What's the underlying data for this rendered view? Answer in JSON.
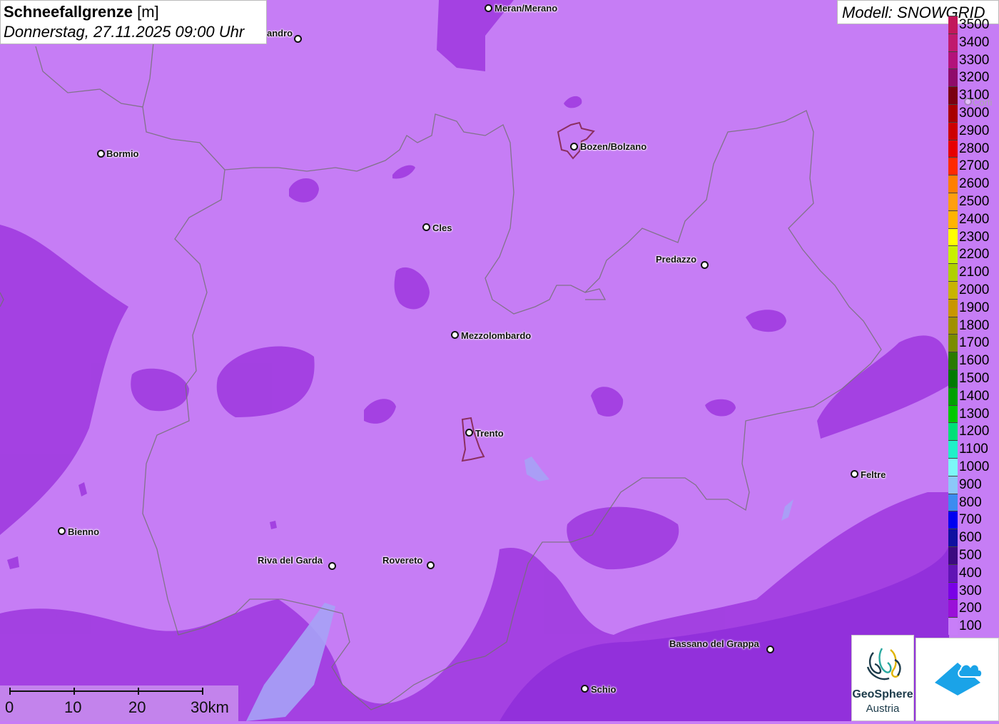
{
  "header": {
    "title_bold": "Schneefallgrenze",
    "title_unit": "[m]",
    "subtitle": "Donnerstag, 27.11.2025 09:00 Uhr",
    "model": "Modell: SNOWGRID"
  },
  "legend": {
    "items": [
      {
        "label": "3500",
        "color": "#c2185b"
      },
      {
        "label": "3400",
        "color": "#c01a6e"
      },
      {
        "label": "3300",
        "color": "#b3127a"
      },
      {
        "label": "3200",
        "color": "#8f0b6a"
      },
      {
        "label": "3100",
        "color": "#7a0010"
      },
      {
        "label": "3000",
        "color": "#a80000"
      },
      {
        "label": "2900",
        "color": "#cc0000"
      },
      {
        "label": "2800",
        "color": "#e60000"
      },
      {
        "label": "2700",
        "color": "#ff2a00"
      },
      {
        "label": "2600",
        "color": "#ff7f00"
      },
      {
        "label": "2500",
        "color": "#ff9f10"
      },
      {
        "label": "2400",
        "color": "#ffb400"
      },
      {
        "label": "2300",
        "color": "#ffff00"
      },
      {
        "label": "2200",
        "color": "#c8f000"
      },
      {
        "label": "2100",
        "color": "#b0d000"
      },
      {
        "label": "2000",
        "color": "#c8b400"
      },
      {
        "label": "1900",
        "color": "#c89600"
      },
      {
        "label": "1800",
        "color": "#a09000"
      },
      {
        "label": "1700",
        "color": "#7a8c00"
      },
      {
        "label": "1600",
        "color": "#2a7a00"
      },
      {
        "label": "1500",
        "color": "#007a00"
      },
      {
        "label": "1400",
        "color": "#00a000"
      },
      {
        "label": "1300",
        "color": "#00c800"
      },
      {
        "label": "1200",
        "color": "#00e078"
      },
      {
        "label": "1100",
        "color": "#20f0c8"
      },
      {
        "label": "1000",
        "color": "#7cf7f7"
      },
      {
        "label": "900",
        "color": "#8cc8f8"
      },
      {
        "label": "800",
        "color": "#3c8cf0"
      },
      {
        "label": "700",
        "color": "#0000f0"
      },
      {
        "label": "600",
        "color": "#1010a0"
      },
      {
        "label": "500",
        "color": "#3c0a80"
      },
      {
        "label": "400",
        "color": "#6014b4"
      },
      {
        "label": "300",
        "color": "#7a00e6"
      },
      {
        "label": "200",
        "color": "#9a10d8"
      },
      {
        "label": "100",
        "color": "#c87ef8"
      }
    ]
  },
  "cities": [
    {
      "name": "Meran/Merano"
    },
    {
      "name": "andro"
    },
    {
      "name": "Bormio"
    },
    {
      "name": "Bozen/Bolzano"
    },
    {
      "name": "Cles"
    },
    {
      "name": "Predazzo"
    },
    {
      "name": "Mezzolombardo"
    },
    {
      "name": "Trento"
    },
    {
      "name": "Feltre"
    },
    {
      "name": "Bienno"
    },
    {
      "name": "Riva del Garda"
    },
    {
      "name": "Rovereto"
    },
    {
      "name": "Bassano del Grappa"
    },
    {
      "name": "Schio"
    },
    {
      "name": "Corti"
    }
  ],
  "scale": {
    "labels": [
      "0",
      "10",
      "20",
      "30km"
    ]
  },
  "logos": {
    "geosphere_line1": "GeoSphere",
    "geosphere_line2": "Austria"
  }
}
